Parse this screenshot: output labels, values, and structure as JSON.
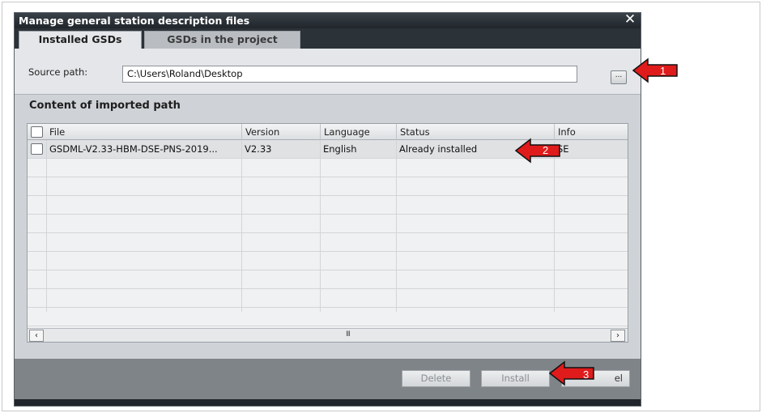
{
  "dialog": {
    "title": "Manage general station description files",
    "close_icon": "close-icon"
  },
  "tabs": [
    {
      "label": "Installed GSDs",
      "active": true
    },
    {
      "label": "GSDs in the project",
      "active": false
    }
  ],
  "source": {
    "label": "Source path:",
    "value": "C:\\Users\\Roland\\Desktop",
    "browse_label": "..."
  },
  "content": {
    "title": "Content of imported path",
    "columns": [
      "File",
      "Version",
      "Language",
      "Status",
      "Info"
    ],
    "rows": [
      {
        "file": "GSDML-V2.33-HBM-DSE-PNS-2019...",
        "version": "V2.33",
        "language": "English",
        "status": "Already installed",
        "info": "SE"
      }
    ],
    "scroll_grip": "III"
  },
  "footer": {
    "delete_label": "Delete",
    "install_label": "Install",
    "cancel_label_visible": "el"
  },
  "annotations": [
    {
      "number": "1",
      "color": "#e01b1b"
    },
    {
      "number": "2",
      "color": "#e01b1b"
    },
    {
      "number": "3",
      "color": "#e01b1b"
    }
  ]
}
